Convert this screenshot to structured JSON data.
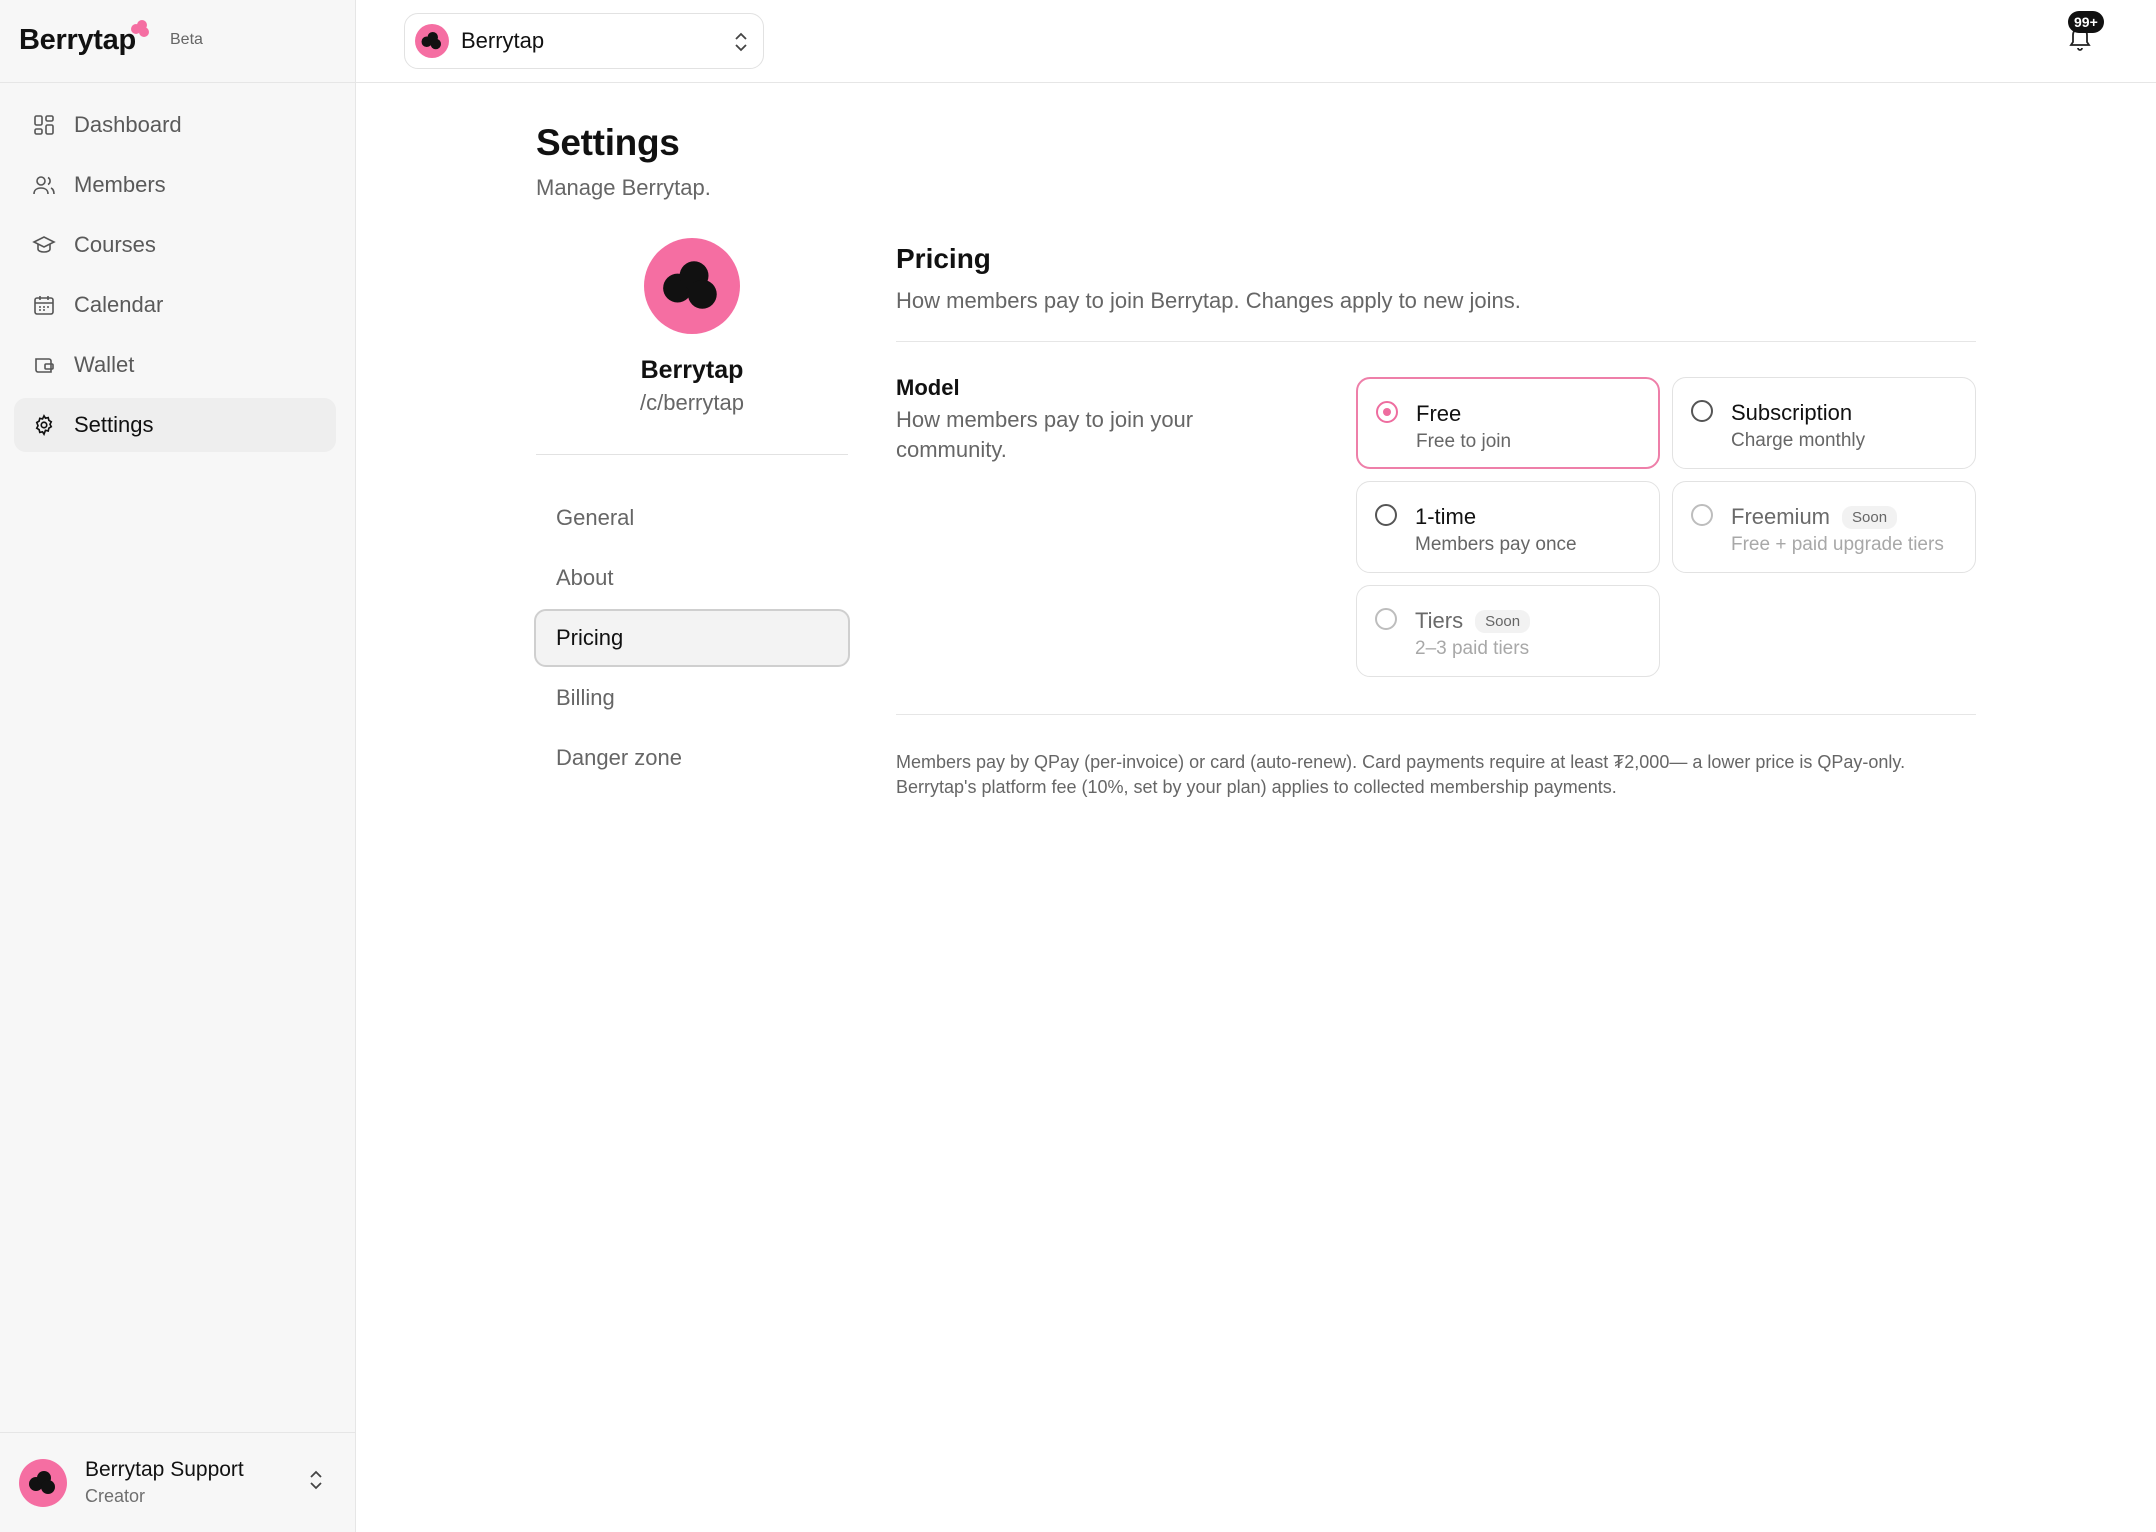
{
  "brand": {
    "name": "Berrytap",
    "badge": "Beta"
  },
  "sidebar": {
    "items": [
      {
        "label": "Dashboard",
        "icon": "grid-icon"
      },
      {
        "label": "Members",
        "icon": "users-icon"
      },
      {
        "label": "Courses",
        "icon": "graduation-cap-icon"
      },
      {
        "label": "Calendar",
        "icon": "calendar-icon"
      },
      {
        "label": "Wallet",
        "icon": "wallet-icon"
      },
      {
        "label": "Settings",
        "icon": "gear-icon",
        "active": true
      }
    ]
  },
  "user": {
    "name": "Berrytap Support",
    "role": "Creator"
  },
  "topbar": {
    "community": "Berrytap",
    "notifications": "99+"
  },
  "page": {
    "title": "Settings",
    "subtitle": "Manage Berrytap."
  },
  "profile": {
    "name": "Berrytap",
    "handle": "/c/berrytap"
  },
  "subnav": {
    "items": [
      {
        "label": "General"
      },
      {
        "label": "About"
      },
      {
        "label": "Pricing",
        "active": true
      },
      {
        "label": "Billing"
      },
      {
        "label": "Danger zone"
      }
    ]
  },
  "pricing": {
    "title": "Pricing",
    "subtitle": "How members pay to join Berrytap. Changes apply to new joins.",
    "model_label": "Model",
    "model_desc": "How members pay to join your community.",
    "options": [
      {
        "title": "Free",
        "desc": "Free to join",
        "selected": true
      },
      {
        "title": "Subscription",
        "desc": "Charge monthly"
      },
      {
        "title": "1-time",
        "desc": "Members pay once"
      },
      {
        "title": "Freemium",
        "desc": "Free + paid upgrade tiers",
        "badge": "Soon",
        "disabled": true
      },
      {
        "title": "Tiers",
        "desc": "2–3 paid tiers",
        "badge": "Soon",
        "disabled": true
      }
    ],
    "footnote": "Members pay by QPay (per-invoice) or card (auto-renew). Card payments require at least ₮2,000— a lower price is QPay-only. Berrytap's platform fee (10%, set by your plan) applies to collected membership payments."
  },
  "colors": {
    "accent": "#f56ea2",
    "selected_border": "#ee7fa9",
    "text": "#111111",
    "muted": "#666666"
  }
}
